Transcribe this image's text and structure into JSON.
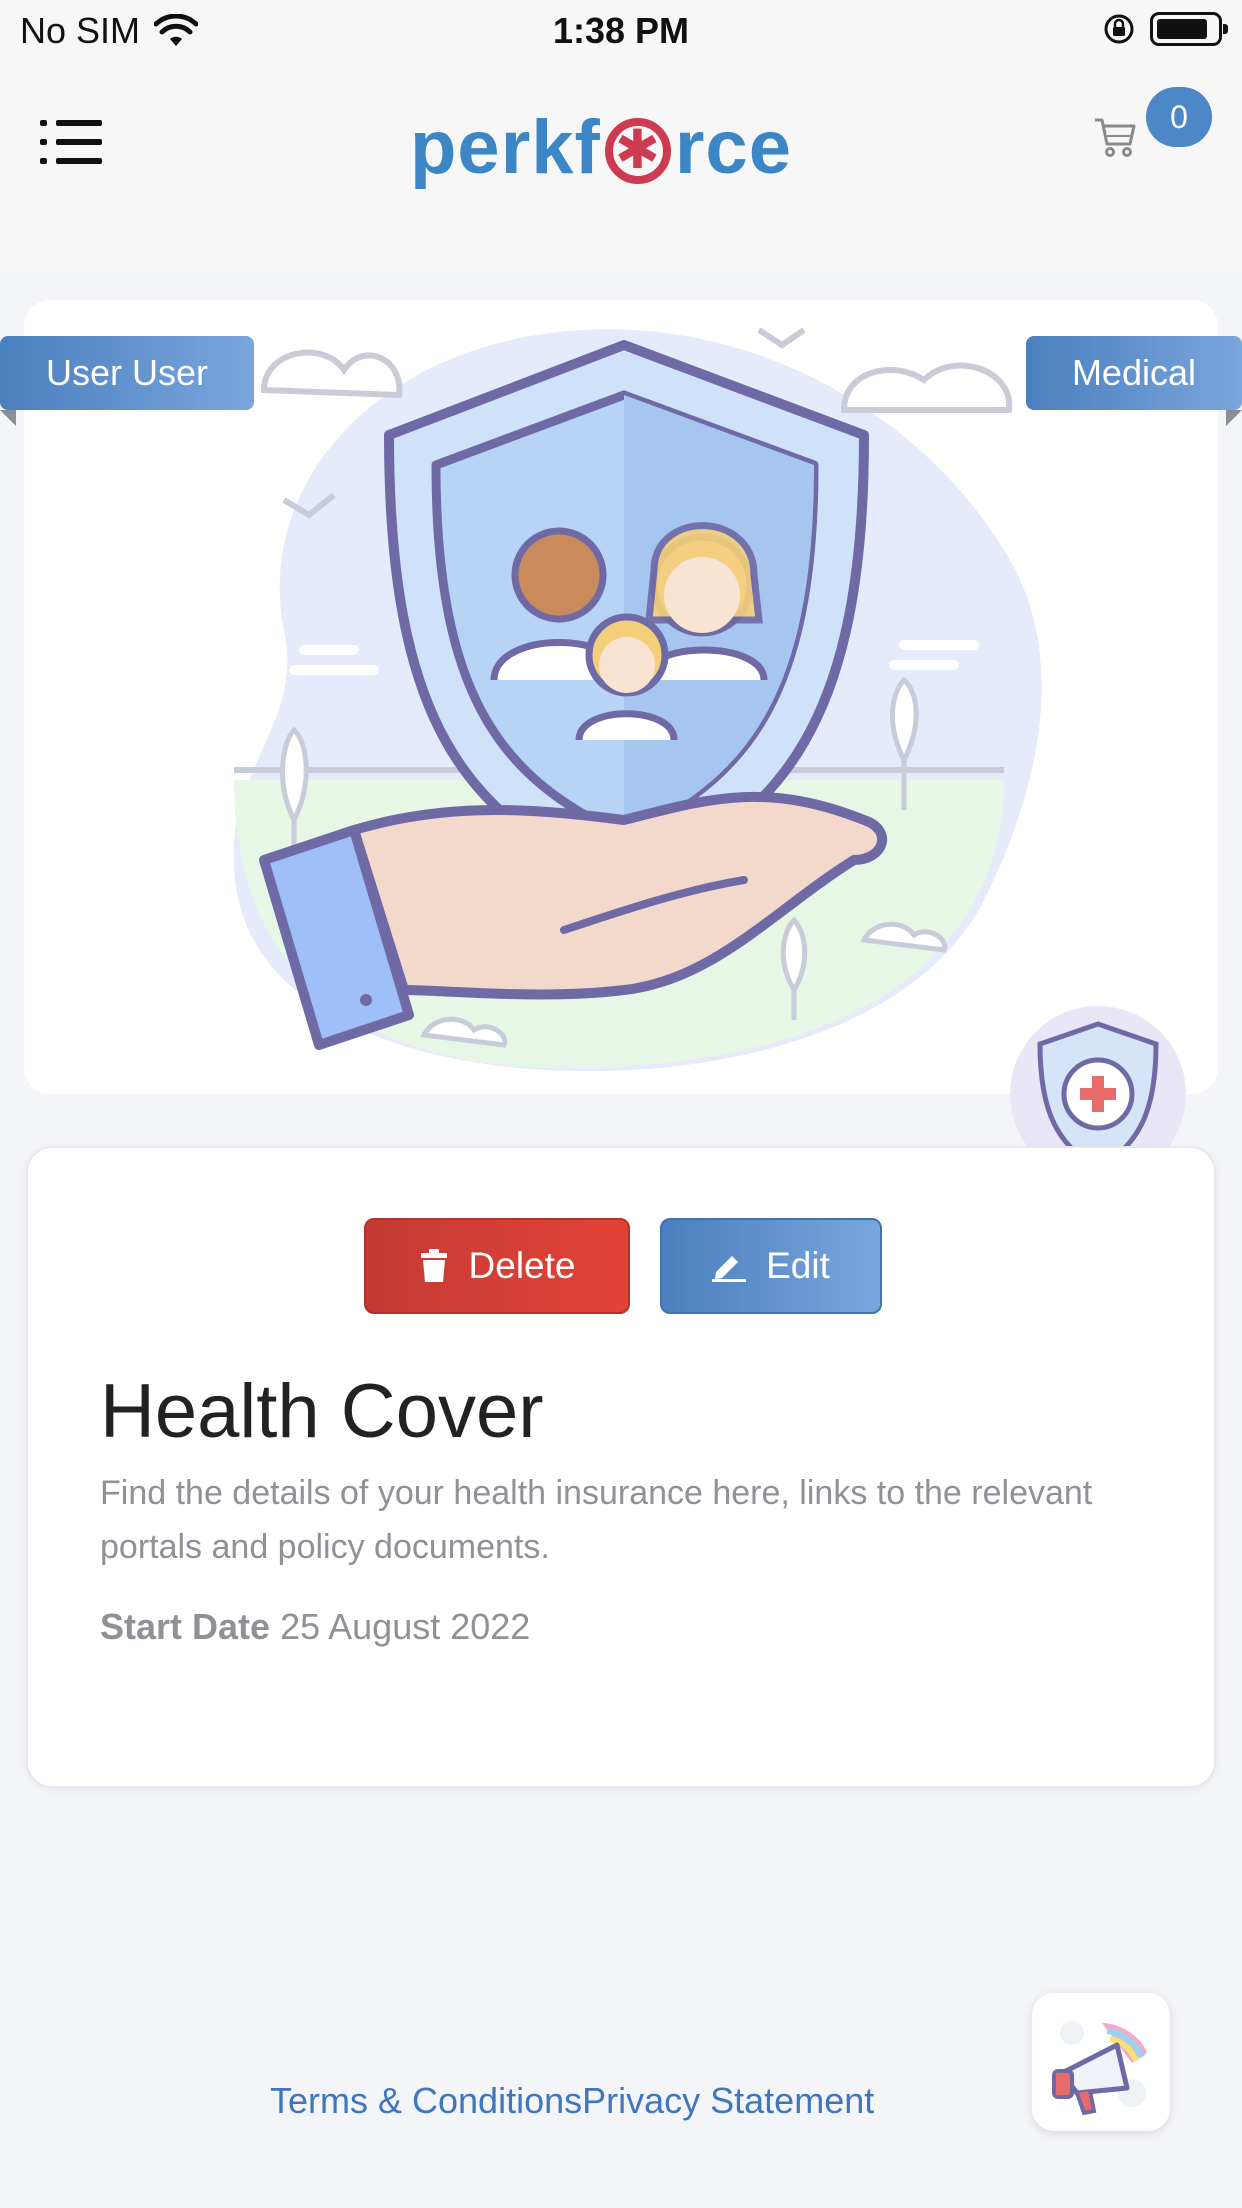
{
  "status_bar": {
    "carrier": "No SIM",
    "time": "1:38 PM"
  },
  "header": {
    "logo_text_left": "perkf",
    "logo_text_right": "rce",
    "cart_count": "0"
  },
  "hero": {
    "user_tag": "User User",
    "category_tag": "Medical"
  },
  "card": {
    "delete_label": "Delete",
    "edit_label": "Edit",
    "title": "Health Cover",
    "description": "Find the details of your health insurance here, links to the relevant portals and policy documents.",
    "start_date_label": "Start Date",
    "start_date_value": "25 August 2022"
  },
  "footer": {
    "terms_label": "Terms & Conditions",
    "privacy_label": "Privacy Statement"
  },
  "colors": {
    "brand_blue": "#4d87c7",
    "delete_red": "#e34337",
    "link_blue": "#3f76bd"
  }
}
